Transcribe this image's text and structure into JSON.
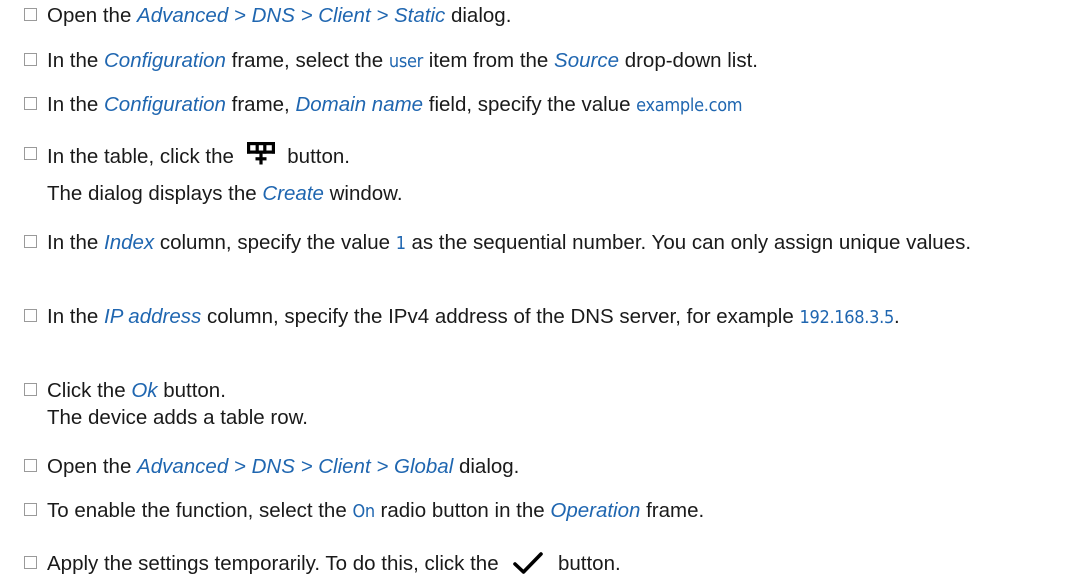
{
  "steps": [
    {
      "a": "Open the ",
      "b": "Advanced > DNS > Client > Static",
      "c": " dialog."
    },
    {
      "a": "In the ",
      "b": "Configuration",
      "c": " frame, select the ",
      "d": "user",
      "e": " item from the ",
      "f": "Source",
      "g": " drop-down list."
    },
    {
      "a": "In the ",
      "b": "Configuration",
      "c": " frame, ",
      "d": "Domain name",
      "e": " field, specify the value ",
      "f": "example.com"
    },
    {
      "a": "In the table, click the ",
      "b": " button.",
      "icon": "table-add-row-icon",
      "result_a": "The dialog displays the ",
      "result_b": "Create",
      "result_c": " window."
    },
    {
      "a": "In the ",
      "b": "Index",
      "c": " column, specify the value ",
      "d": "1",
      "e": " as the sequential number. You can only assign unique values."
    },
    {
      "a": "In the ",
      "b": "IP address",
      "c": " column, specify the IPv4 address of the DNS server, for example ",
      "d": "192.168.3.5",
      "e": "."
    },
    {
      "a": "Click the ",
      "b": "Ok",
      "c": " button.",
      "result": "The device adds a table row."
    },
    {
      "a": "Open the ",
      "b": "Advanced > DNS > Client > Global",
      "c": " dialog."
    },
    {
      "a": "To enable the function, select the ",
      "b": "On",
      "c": " radio button in the ",
      "d": "Operation",
      "e": " frame."
    },
    {
      "a": "Apply the settings temporarily. To do this, click the ",
      "b": " button.",
      "icon": "checkmark-icon"
    }
  ],
  "colors": {
    "ui_text": "#1f66b0",
    "body_text": "#1a1a1a",
    "checkbox_border": "#9a9a9a"
  }
}
